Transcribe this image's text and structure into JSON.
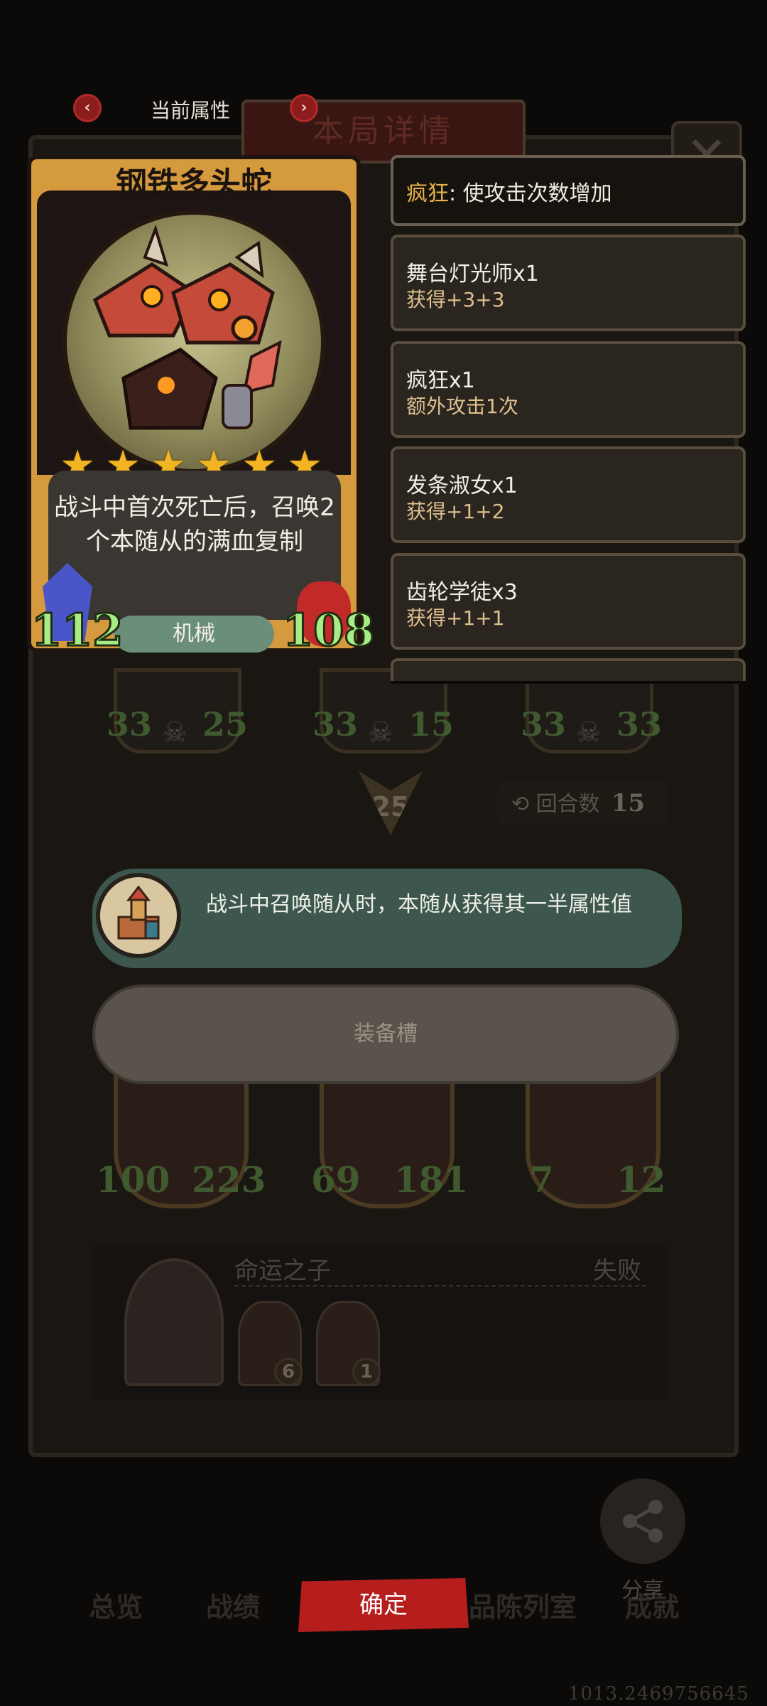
{
  "popup": {
    "title": "当前属性",
    "prev_arrow": "‹",
    "next_arrow": "›"
  },
  "card": {
    "name": "钢铁多头蛇",
    "stars": 6,
    "description": "战斗中首次死亡后，召唤2个本随从的满血复制",
    "tribe": "机械",
    "attack": "112",
    "health": "108"
  },
  "keyword": {
    "name": "疯狂",
    "text": ": 使攻击次数增加"
  },
  "buffs": [
    {
      "name": "舞台灯光师x1",
      "desc": "获得+3+3"
    },
    {
      "name": "疯狂x1",
      "desc": "额外攻击1次"
    },
    {
      "name": "发条淑女x1",
      "desc": "获得+1+2"
    },
    {
      "name": "齿轮学徒x3",
      "desc": "获得+1+1"
    }
  ],
  "skill_tooltip": {
    "text": "战斗中召唤随从时，本随从获得其一半属性值"
  },
  "equip_slot": {
    "label": "装备槽"
  },
  "background": {
    "panel_title": "本局详情",
    "close": "✕",
    "top_units": [
      {
        "atk": "33",
        "hp": "25"
      },
      {
        "atk": "33",
        "hp": "15"
      },
      {
        "atk": "33",
        "hp": "33"
      }
    ],
    "attack_marker": "25",
    "round_label": "回合数",
    "round_value": "15",
    "bottom_units": [
      {
        "atk": "100",
        "hp": "223"
      },
      {
        "atk": "69",
        "hp": "181"
      },
      {
        "atk": "7",
        "hp": "12"
      }
    ],
    "player": {
      "name": "命运之子",
      "result": "失败",
      "minion_badges": [
        "6",
        "1"
      ]
    }
  },
  "bottom_nav": {
    "tabs": [
      "总览",
      "战绩",
      "品陈列室",
      "成就"
    ],
    "confirm": "确定",
    "share": "分享"
  },
  "coord_readout": "1013.2469756645",
  "colors": {
    "card_gold": "#d69a3e",
    "stat_green": "#a8ec86",
    "confirm_red": "#b61e1e",
    "tooltip_teal": "#3d574e",
    "keyword_gold": "#e8b44a"
  }
}
